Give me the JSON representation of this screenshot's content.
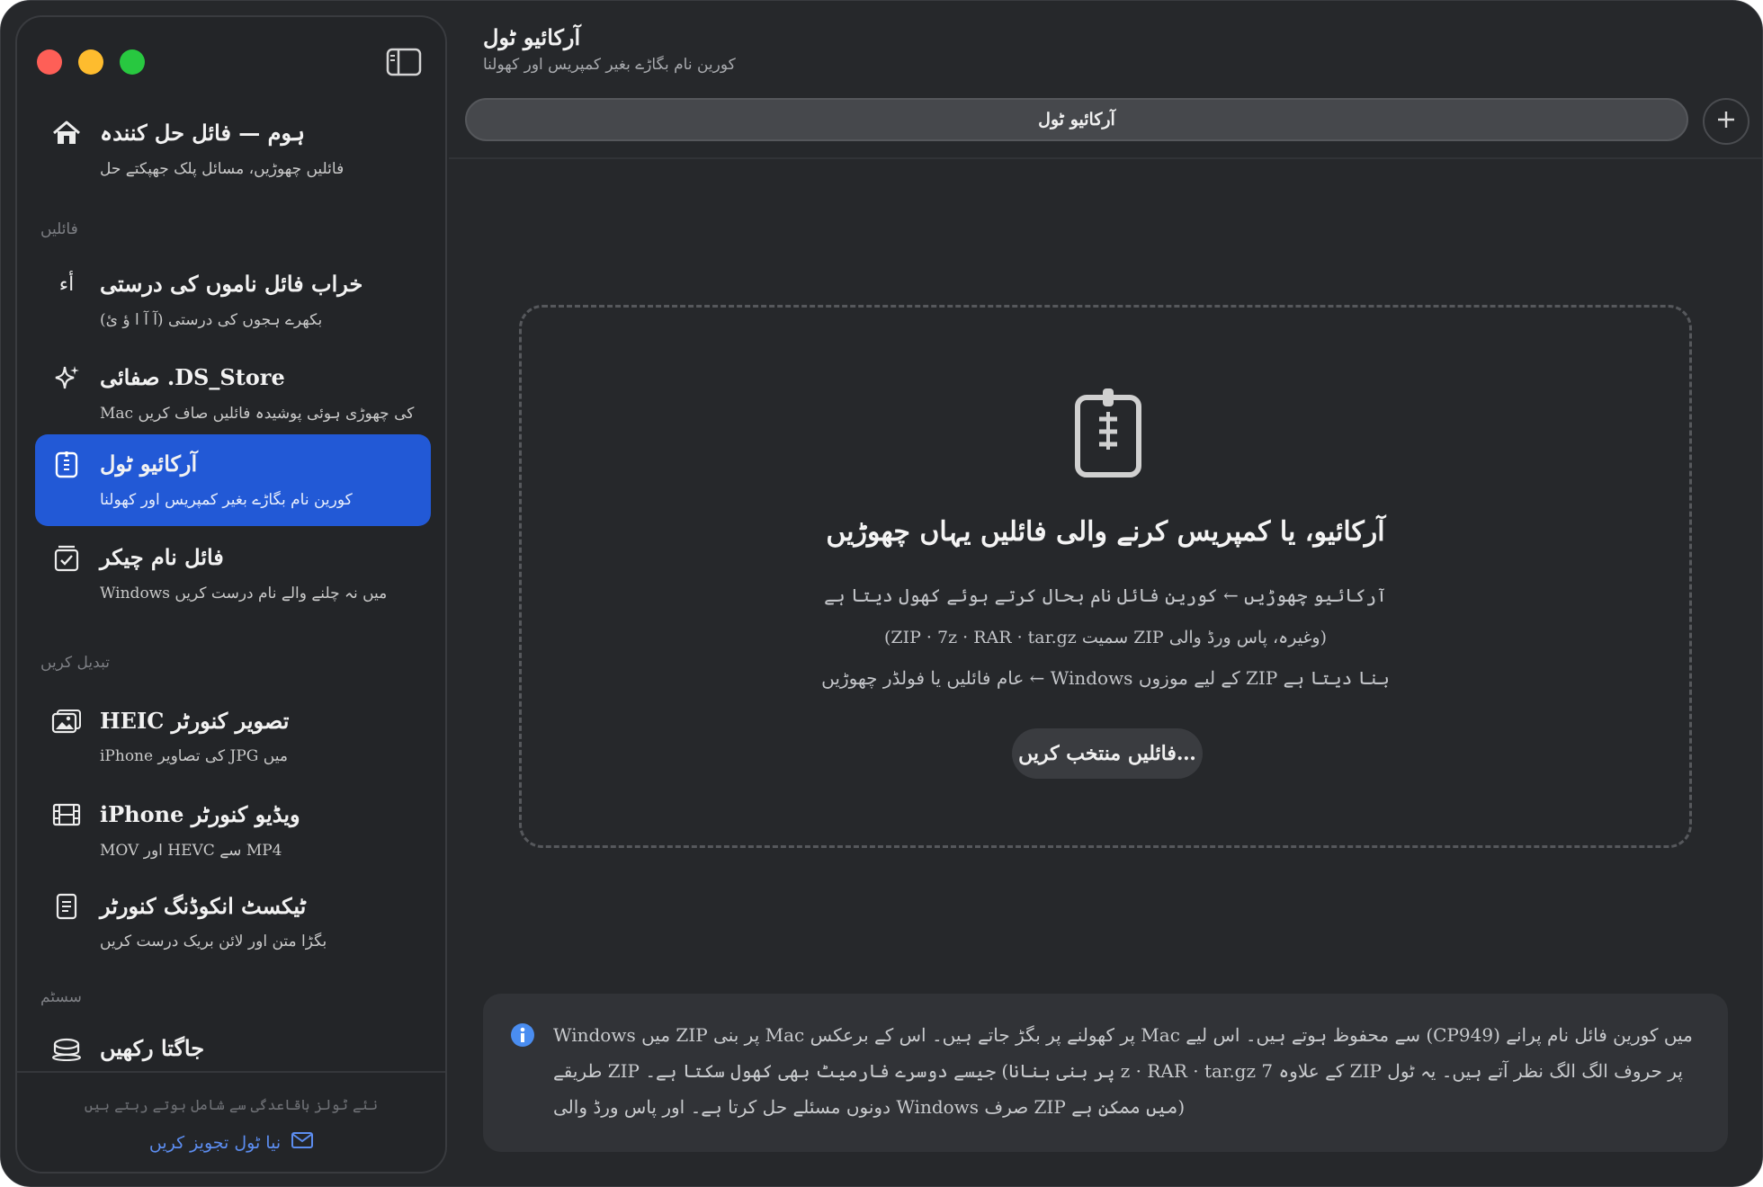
{
  "window": {
    "title": "آرکائیو ٹول",
    "subtitle": "کورین نام بگاڑے بغیر کمپریس اور کھولنا"
  },
  "sidebar": {
    "items": [
      {
        "title": "ہوم — فائل حل کنندہ",
        "subtitle": "فائلیں چھوڑیں، مسائل پلک جھپکتے حل",
        "icon": "home-icon"
      },
      {
        "title": "خراب فائل ناموں کی درستی",
        "subtitle": "بکھرے ہجوں کی درستی (آ آ ا ؤ ئ)",
        "icon": "text-glyph-icon",
        "glyph": "أء"
      },
      {
        "title": "صفائی .DS_Store",
        "subtitle": "Mac کی چھوڑی ہوئی پوشیدہ فائلیں صاف کریں",
        "icon": "sparkle-icon"
      },
      {
        "title": "آرکائیو ٹول",
        "subtitle": "کورین نام بگاڑے بغیر کمپریس اور کھولنا",
        "icon": "archive-icon",
        "active": true
      },
      {
        "title": "فائل نام چیکر",
        "subtitle": "Windows میں نہ چلنے والے نام درست کریں",
        "icon": "checklist-icon"
      },
      {
        "title": "HEIC تصویر کنورٹر",
        "subtitle": "iPhone کی تصاویر JPG میں",
        "icon": "photos-icon"
      },
      {
        "title": "iPhone ویڈیو کنورٹر",
        "subtitle": "MOV اور HEVC سے MP4",
        "icon": "film-icon"
      },
      {
        "title": "ٹیکسٹ انکوڈنگ کنورٹر",
        "subtitle": "بگڑا متن اور لائن بریک درست کریں",
        "icon": "document-icon"
      },
      {
        "title": "جاگتا رکھیں",
        "icon": "coffee-cup-icon"
      }
    ],
    "sections": {
      "files": "فائلیں",
      "convert": "تبدیل کریں",
      "system": "سسٹم"
    },
    "footer": {
      "note": "نئے ٹولز باقاعدگی سے شامل ہوتے رہتے ہیں",
      "suggest": "نیا ٹول تجویز کریں"
    }
  },
  "tabs": {
    "active_label": "آرکائیو ٹول",
    "add_icon": "plus-icon"
  },
  "dropzone": {
    "heading": "آرکائیو، یا کمپریس کرنے والی فائلیں یہاں چھوڑیں",
    "line1": "آرکائیو چھوڑیں ← کورین فائل نام بحال کرتے ہوئے کھول دیتا ہے",
    "line2": "(ZIP · 7z · RAR · tar.gz سمیت ZIP وغیرہ، پاس ورڈ والی)",
    "line3": "عام فائلیں یا فولڈر چھوڑیں ← Windows کے لیے موزوں ZIP بنا دیتا ہے",
    "button": "فائلیں منتخب کریں…"
  },
  "info": {
    "text": "Windows میں ZIP پر بنی Mac پر کھولنے پر بگڑ جاتے ہیں۔ اس کے برعکس Mac سے محفوظ ہوتے ہیں۔ اس لیے (CP949) میں کورین فائل نام پرانے طریقے ZIP پر بنی بنانا) جیسے دوسرے فارمیٹ بھی کھول سکتا ہے۔ z · RAR · tar.gz کے علاوہ 7 ZIP پر حروف الگ الگ نظر آتے ہیں۔ یہ ٹول دونوں مسئلے حل کرتا ہے۔ اور پاس ورڈ والی Windows صرف ZIP میں ممکن ہے)"
  },
  "colors": {
    "window_bg": "#26282b",
    "sidebar_bg": "#232528",
    "accent": "#2259d6",
    "link": "#5c8df0",
    "info_icon": "#4a8df0"
  }
}
